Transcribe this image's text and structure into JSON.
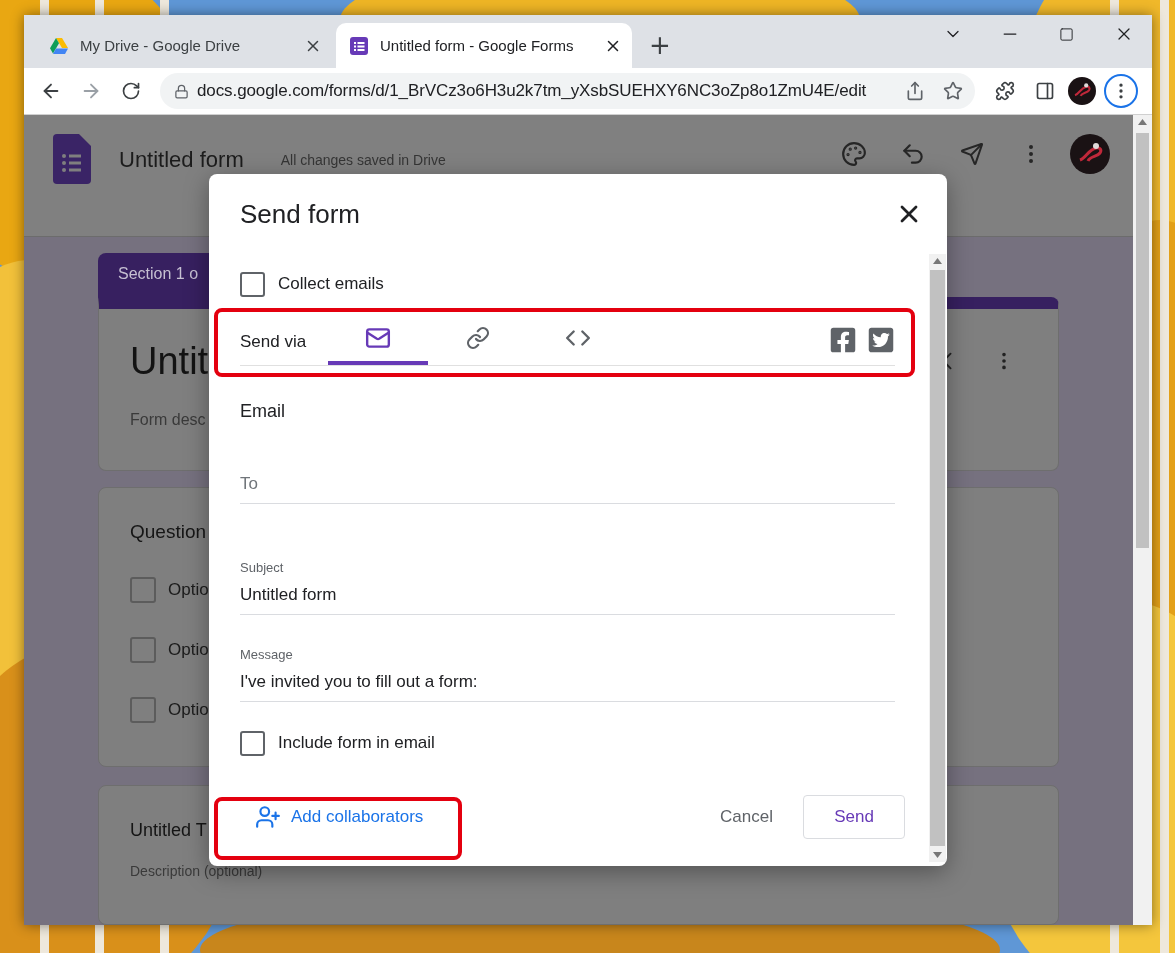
{
  "browser": {
    "tabs": [
      {
        "title": "My Drive - Google Drive",
        "kind": "drive",
        "selected": false
      },
      {
        "title": "Untitled form - Google Forms",
        "kind": "forms",
        "selected": true
      }
    ],
    "new_tab": "+",
    "url": "docs.google.com/forms/d/1_BrVCz3o6H3u2k7tm_yXsbSUEHXY6NC3oZp8o1ZmU4E/edit"
  },
  "form_header": {
    "title": "Untitled form",
    "status": "All changes saved in Drive"
  },
  "background_form": {
    "section_tab": "Section 1 o",
    "title": "Untit",
    "description": "Form desc",
    "question": "Question",
    "options": [
      {
        "label": "Optio",
        "checked": false
      },
      {
        "label": "Optio",
        "checked": false
      },
      {
        "label": "Optio",
        "checked": false
      }
    ],
    "next_title": "Untitled T",
    "next_description": "Description (optional)"
  },
  "dialog": {
    "title": "Send form",
    "collect_emails": {
      "label": "Collect emails",
      "checked": false
    },
    "send_via": {
      "label": "Send via",
      "tabs": [
        {
          "kind": "email",
          "selected": true
        },
        {
          "kind": "link",
          "selected": false
        },
        {
          "kind": "embed",
          "selected": false
        }
      ],
      "share": [
        {
          "kind": "facebook"
        },
        {
          "kind": "twitter"
        }
      ]
    },
    "email": {
      "heading": "Email",
      "to": {
        "placeholder": "To"
      },
      "subject": {
        "label": "Subject",
        "value": "Untitled form"
      },
      "message": {
        "label": "Message",
        "value": "I've invited you to fill out a form:"
      },
      "include_form": {
        "label": "Include form in email",
        "checked": false
      }
    },
    "footer": {
      "add_collaborators": "Add collaborators",
      "cancel": "Cancel",
      "send": "Send"
    }
  }
}
